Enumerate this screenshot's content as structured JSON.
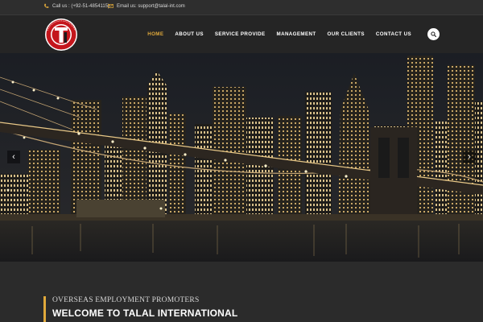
{
  "topbar": {
    "phone": "Call us : (+92-51-4854115)",
    "email": "Email us: support@talal-int.com"
  },
  "logo": {
    "text": "TALAL INTERNATIONAL",
    "mark": "TI"
  },
  "nav": {
    "items": [
      {
        "label": "HOME"
      },
      {
        "label": "ABOUT US"
      },
      {
        "label": "SERVICE PROVIDE"
      },
      {
        "label": "MANAGEMENT"
      },
      {
        "label": "OUR CLIENTS"
      },
      {
        "label": "CONTACT US"
      }
    ]
  },
  "hero": {
    "prev_icon": "chevron-left-icon",
    "next_icon": "chevron-right-icon"
  },
  "intro": {
    "subtitle": "OVERSEAS EMPLOYMENT PROMOTERS",
    "title": "WELCOME TO TALAL INTERNATIONAL"
  },
  "colors": {
    "accent": "#e0a93b",
    "header_bg": "#252525",
    "topbar_bg": "#2e2e2e",
    "page_bg": "#2b2b2b"
  }
}
